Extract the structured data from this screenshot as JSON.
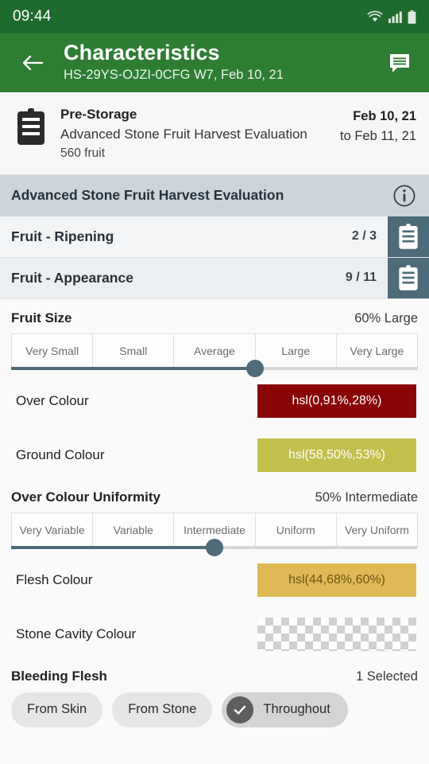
{
  "status_bar": {
    "time": "09:44",
    "icons": [
      "wifi-icon",
      "cellular-signal-icon",
      "battery-icon"
    ]
  },
  "app_bar": {
    "back_icon": "arrow-left-icon",
    "title": "Characteristics",
    "subtitle": "HS-29YS-OJZI-0CFG W7, Feb 10, 21",
    "comment_icon": "comment-icon",
    "background_color": "#2e7d33"
  },
  "summary": {
    "icon": "clipboard-icon",
    "stage": "Pre-Storage",
    "protocol": "Advanced Stone Fruit Harvest Evaluation",
    "sample_count": "560 fruit",
    "date_from": "Feb 10, 21",
    "date_to": "to Feb 11, 21"
  },
  "protocol_band": {
    "title": "Advanced Stone Fruit Harvest Evaluation",
    "info_icon": "info-circle-icon",
    "background_color": "#ccd5dc"
  },
  "groups": [
    {
      "label": "Fruit - Ripening",
      "count": "2 / 3",
      "badge_icon": "clipboard-icon"
    },
    {
      "label": "Fruit - Appearance",
      "count": "9 / 11",
      "badge_icon": "clipboard-icon"
    }
  ],
  "fields": {
    "fruit_size": {
      "label": "Fruit Size",
      "value": "60% Large",
      "percent": 60,
      "options": [
        "Very Small",
        "Small",
        "Average",
        "Large",
        "Very Large"
      ]
    },
    "over_colour": {
      "label": "Over Colour",
      "value": "hsl(0,91%,28%)",
      "swatch_color": "hsl(0,91%,28%)",
      "text_color": "#ffffff"
    },
    "ground_colour": {
      "label": "Ground Colour",
      "value": "hsl(58,50%,53%)",
      "swatch_color": "hsl(58,50%,53%)",
      "text_color": "#ffffff"
    },
    "over_colour_uniformity": {
      "label": "Over Colour Uniformity",
      "value": "50% Intermediate",
      "percent": 50,
      "options": [
        "Very Variable",
        "Variable",
        "Intermediate",
        "Uniform",
        "Very Uniform"
      ]
    },
    "flesh_colour": {
      "label": "Flesh Colour",
      "value": "hsl(44,68%,60%)",
      "swatch_color": "hsl(44,68%,60%)",
      "text_color": "#6b5512"
    },
    "stone_cavity_colour": {
      "label": "Stone Cavity Colour",
      "value": "",
      "swatch_color": "transparent",
      "text_color": "#000000"
    },
    "bleeding_flesh": {
      "label": "Bleeding Flesh",
      "value": "1 Selected",
      "options": [
        {
          "label": "From Skin",
          "selected": false
        },
        {
          "label": "From Stone",
          "selected": false
        },
        {
          "label": "Throughout",
          "selected": true
        }
      ],
      "check_icon": "check-icon"
    }
  }
}
